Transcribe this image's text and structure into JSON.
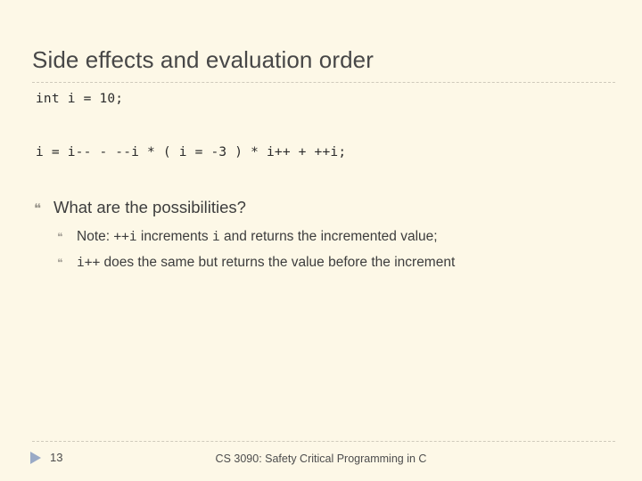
{
  "slide": {
    "title": "Side effects and evaluation order",
    "background_color": "#fdf8e7",
    "rule_color": "#cfcabb",
    "title_color": "#474747",
    "body_color": "#3d3d3d"
  },
  "code_lines": {
    "line_1": "int i = 10;",
    "line_2": "i = i-- - --i * ( i = -3 ) * i++ + ++i;"
  },
  "bullets": {
    "marker_glyph": "❝",
    "level1": {
      "text": "What are the possibilities?"
    },
    "level2": [
      {
        "prefix": "Note: ",
        "code_1": "++i",
        "middle": " increments ",
        "code_2": "i",
        "suffix": " and returns the incremented value;"
      },
      {
        "prefix": "",
        "code_1": "i++",
        "middle": " does the same but returns the value before the increment",
        "code_2": "",
        "suffix": ""
      }
    ]
  },
  "footer": {
    "slide_number": "13",
    "course_text": "CS 3090: Safety Critical Programming in C",
    "triangle_color": "#9aaac6"
  }
}
